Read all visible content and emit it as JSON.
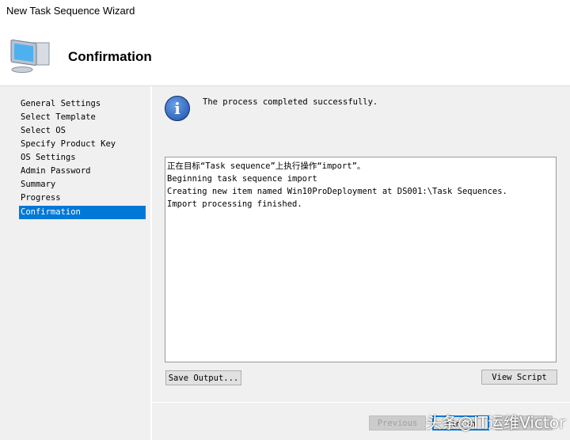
{
  "window": {
    "title": "New Task Sequence Wizard"
  },
  "header": {
    "title": "Confirmation",
    "icon": "computer-icon"
  },
  "nav": {
    "items": [
      "General Settings",
      "Select Template",
      "Select OS",
      "Specify Product Key",
      "OS Settings",
      "Admin Password",
      "Summary",
      "Progress",
      "Confirmation"
    ],
    "selected": "Confirmation"
  },
  "main": {
    "message": "The process completed successfully.",
    "log": [
      "正在目标“Task sequence”上执行操作“import”。",
      "Beginning task sequence import",
      "Creating new item named Win10ProDeployment at DS001:\\Task Sequences.",
      "Import processing finished."
    ]
  },
  "buttons": {
    "save_output": "Save Output...",
    "view_script": "View Script",
    "previous": "Previous",
    "finish": "Finish",
    "cancel": "Cancel"
  },
  "watermark": "头条@IT运维Victor"
}
